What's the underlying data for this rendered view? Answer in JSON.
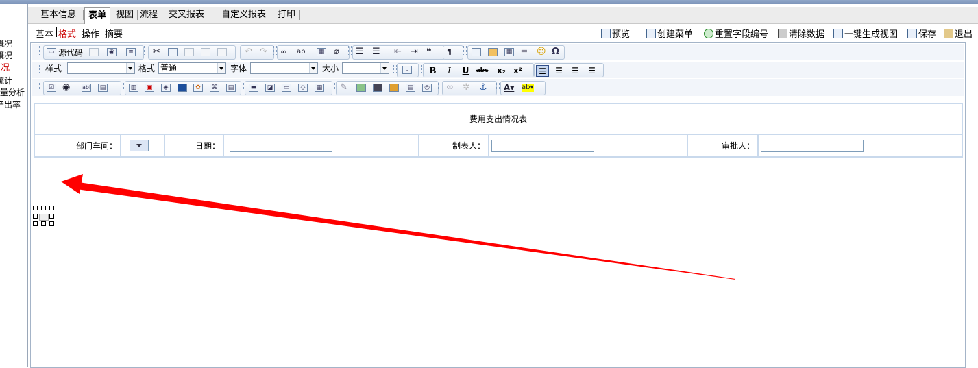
{
  "left_nav": {
    "items": [
      {
        "label": "概况",
        "color": "#000000"
      },
      {
        "label": "概况",
        "color": "#000000"
      },
      {
        "label": "情况",
        "color": "#cc0000"
      },
      {
        "label": "统计",
        "color": "#000000"
      },
      {
        "label": "含量分析",
        "color": "#000000"
      },
      {
        "label": "产出率",
        "color": "#000000"
      }
    ]
  },
  "tabs": [
    "基本信息",
    "表单",
    "视图",
    "流程",
    "交叉报表",
    "自定义报表",
    "打印"
  ],
  "active_tab": "表单",
  "sub_tabs": [
    "基本",
    "格式",
    "操作",
    "摘要"
  ],
  "active_sub_tab": "格式",
  "actions": [
    "预览",
    "创建菜单",
    "重置字段编号",
    "清除数据",
    "一键生成视图",
    "保存",
    "退出"
  ],
  "toolbar": {
    "source_label": "源代码",
    "style_label": "样式",
    "format_label": "格式",
    "format_value": "普通",
    "font_label": "字体",
    "size_label": "大小",
    "style_value": "",
    "font_value": "",
    "size_value": ""
  },
  "form": {
    "title": "费用支出情况表",
    "dept_label": "部门车间：",
    "date_label": "日期：",
    "maker_label": "制表人：",
    "approver_label": "审批人："
  },
  "colors": {
    "accent_red": "#ff0000",
    "border_blue": "#c9d9ec",
    "tab_bg": "#ececec"
  }
}
